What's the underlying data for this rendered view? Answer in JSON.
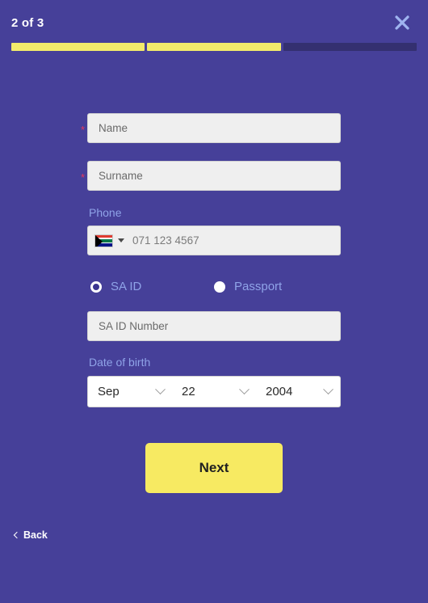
{
  "header": {
    "step_label": "2 of 3",
    "close_icon": "close-x-icon"
  },
  "progress": {
    "total_steps": 3,
    "completed_steps": 2,
    "segments": [
      {
        "state": "filled"
      },
      {
        "state": "filled"
      },
      {
        "state": "empty"
      }
    ],
    "filled_color": "#f2eb6b",
    "empty_color": "#343070"
  },
  "form": {
    "name": {
      "placeholder": "Name",
      "value": "",
      "required_marker": "*"
    },
    "surname": {
      "placeholder": "Surname",
      "value": "",
      "required_marker": "*"
    },
    "phone": {
      "label": "Phone",
      "placeholder": "071 123 4567",
      "value": "",
      "country_flag": "south-africa-flag-icon",
      "caret_icon": "caret-down-icon"
    },
    "id_type": {
      "options": [
        {
          "label": "SA ID",
          "selected": true
        },
        {
          "label": "Passport",
          "selected": false
        }
      ]
    },
    "id_number": {
      "placeholder": "SA ID Number",
      "value": ""
    },
    "date_of_birth": {
      "label": "Date of birth",
      "month": "Sep",
      "day": "22",
      "year": "2004",
      "chevron_icon": "chevron-down-icon"
    }
  },
  "actions": {
    "next_label": "Next",
    "back_label": "Back",
    "back_chevron_icon": "chevron-left-icon"
  },
  "colors": {
    "background": "#464099",
    "accent_yellow": "#f7ea62",
    "label_blue": "#8fa3e8",
    "required_red": "#e8395c"
  }
}
